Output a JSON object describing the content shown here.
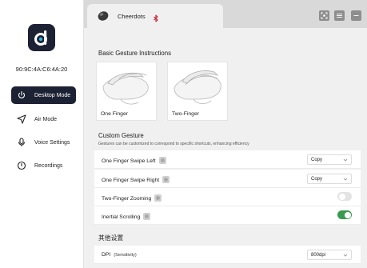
{
  "sidebar": {
    "mac_address": "90:9C:4A:C6:4A:20",
    "items": [
      {
        "label": "Desktop Mode",
        "icon": "power-icon",
        "active": true
      },
      {
        "label": "Air Mode",
        "icon": "paper-plane-icon",
        "active": false
      },
      {
        "label": "Voice Settings",
        "icon": "microphone-icon",
        "active": false
      },
      {
        "label": "Recordings",
        "icon": "recordings-icon",
        "active": false
      }
    ]
  },
  "header": {
    "device_name": "Cheerdots",
    "bluetooth_icon": "bluetooth-icon",
    "buttons": [
      "scan-icon",
      "menu-icon",
      "minimize-icon"
    ]
  },
  "basic": {
    "title": "Basic Gesture Instructions",
    "cards": [
      {
        "label": "One Finger"
      },
      {
        "label": "Two-Finger"
      }
    ]
  },
  "custom": {
    "title": "Custom Gesture",
    "subtitle": "Gestures can be customized to correspond to specific shortcuts, enhancing efficiency",
    "rows": [
      {
        "label": "One Finger Swipe Left",
        "value": "Copy"
      },
      {
        "label": "One Finger Swipe Right",
        "value": "Copy"
      },
      {
        "label": "Two-Finger Zooming",
        "toggle": false
      },
      {
        "label": "Inertial Scrolling",
        "toggle": true
      }
    ]
  },
  "other": {
    "title": "其他设置",
    "dpi_label": "DPI",
    "dpi_sub": "(Sensitivity)",
    "dpi_value": "800dpi"
  },
  "colors": {
    "sidebar_active": "#1c2233",
    "toggle_on": "#3a9a50",
    "bluetooth": "#cc2233"
  }
}
